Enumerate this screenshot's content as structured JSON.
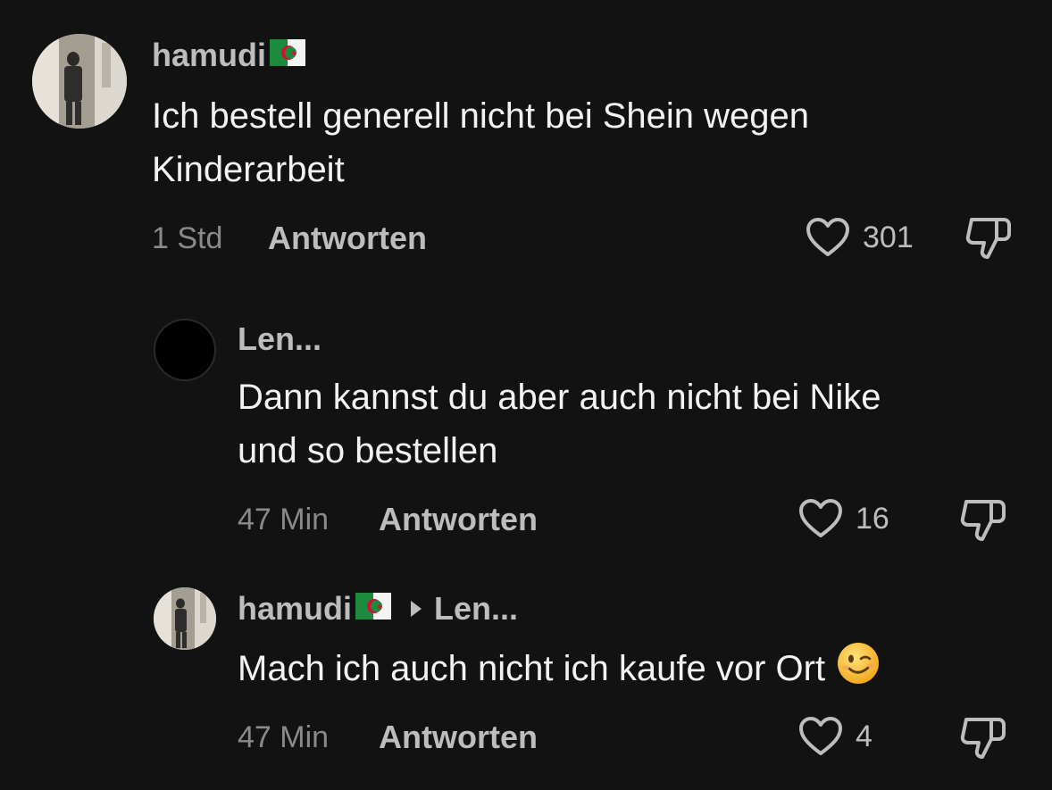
{
  "comments": [
    {
      "username": "hamudi",
      "text_lines": [
        "Ich bestell generell nicht bei Shein wegen",
        "Kinderarbeit"
      ],
      "time": "1 Std",
      "reply_label": "Antworten",
      "likes": "301",
      "flag_icon": "algeria-flag-icon"
    },
    {
      "username": "Len...",
      "text_lines": [
        "Dann kannst du aber auch nicht bei Nike",
        "und so bestellen"
      ],
      "time": "47 Min",
      "reply_label": "Antworten",
      "likes": "16"
    },
    {
      "username": "hamudi",
      "reply_to": "Len...",
      "text_lines": [
        "Mach ich auch nicht ich kaufe vor Ort"
      ],
      "time": "47 Min",
      "reply_label": "Antworten",
      "likes": "4",
      "flag_icon": "algeria-flag-icon",
      "emoji_icon": "winking-face-emoji"
    }
  ],
  "colors": {
    "background": "#121212",
    "text": "#f2f2f2",
    "muted": "#8a8a8a",
    "username": "#bdbdbd"
  }
}
